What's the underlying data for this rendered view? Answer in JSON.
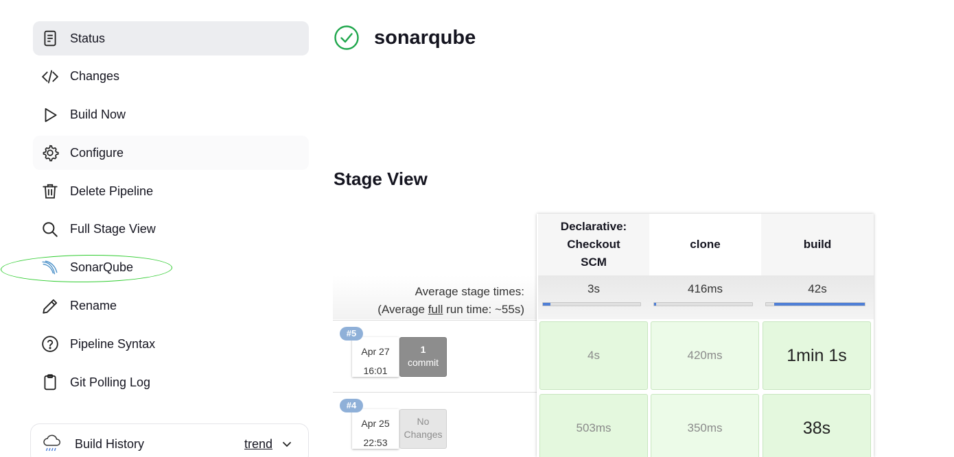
{
  "sidebar": {
    "items": [
      {
        "label": "Status",
        "icon": "status-icon"
      },
      {
        "label": "Changes",
        "icon": "code-icon"
      },
      {
        "label": "Build Now",
        "icon": "play-icon"
      },
      {
        "label": "Configure",
        "icon": "gear-icon"
      },
      {
        "label": "Delete Pipeline",
        "icon": "trash-icon"
      },
      {
        "label": "Full Stage View",
        "icon": "search-icon"
      },
      {
        "label": "SonarQube",
        "icon": "sonarqube-icon"
      },
      {
        "label": "Rename",
        "icon": "pencil-icon"
      },
      {
        "label": "Pipeline Syntax",
        "icon": "help-icon"
      },
      {
        "label": "Git Polling Log",
        "icon": "clipboard-icon"
      }
    ]
  },
  "build_history": {
    "label": "Build History",
    "trend": "trend"
  },
  "page": {
    "title": "sonarqube",
    "status_color": "#1ea64b"
  },
  "stage_view": {
    "title": "Stage View",
    "stages": [
      "Declarative: Checkout SCM",
      "clone",
      "build"
    ],
    "average": {
      "label_line1": "Average stage times:",
      "label_prefix": "(Average ",
      "label_full": "full",
      "label_suffix": " run time: ~55s)",
      "times": [
        "3s",
        "416ms",
        "42s"
      ]
    },
    "runs": [
      {
        "number": "#5",
        "date": "Apr 27",
        "time": "16:01",
        "changes_count": "1",
        "changes_label": "commit",
        "durations": [
          "4s",
          "420ms",
          "1min 1s"
        ]
      },
      {
        "number": "#4",
        "date": "Apr 25",
        "time": "22:53",
        "changes_count": "No",
        "changes_label": "Changes",
        "durations": [
          "503ms",
          "350ms",
          "38s"
        ]
      }
    ]
  },
  "colors": {
    "success_cell": "#e4f8de",
    "accent_bar": "#4f7fd6",
    "highlight": "#2ecc2e"
  }
}
